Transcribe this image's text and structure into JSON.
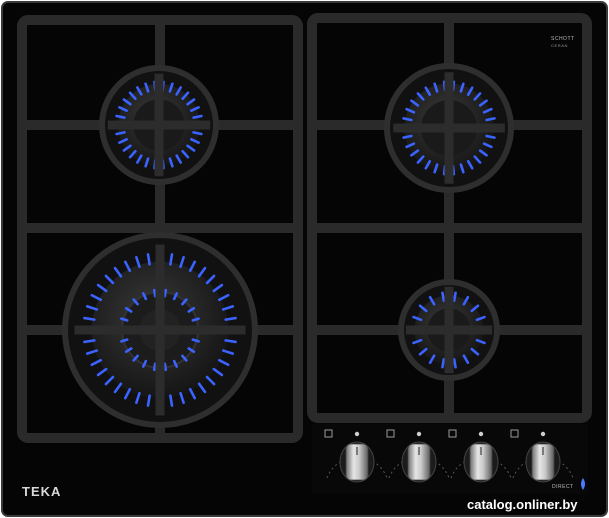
{
  "brand": "TEKA",
  "schott_line1": "SCHOTT",
  "schott_line2": "CERAN",
  "flame_logo": "DIRECT",
  "watermark": "catalog.onliner.by",
  "colors": {
    "glass": "#050505",
    "grate": "#2b2b2b",
    "flame": "#3a63ff",
    "knob": "#b9b9b9"
  },
  "icons": [
    "burner-indicator-icon",
    "knob-position-dot-icon",
    "flame-logo-icon"
  ],
  "burners": [
    {
      "name": "rear-left",
      "type": "medium",
      "lit": true
    },
    {
      "name": "rear-right",
      "type": "medium",
      "lit": true
    },
    {
      "name": "front-left",
      "type": "triple-crown",
      "lit": true
    },
    {
      "name": "front-right",
      "type": "auxiliary",
      "lit": true
    }
  ],
  "knobs": [
    {
      "name": "knob-1"
    },
    {
      "name": "knob-2"
    },
    {
      "name": "knob-3"
    },
    {
      "name": "knob-4"
    }
  ]
}
